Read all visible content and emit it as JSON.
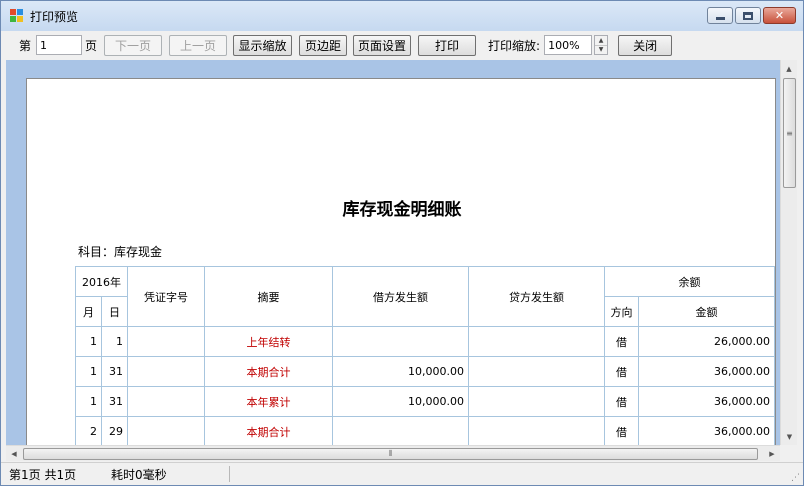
{
  "window": {
    "title": "打印预览"
  },
  "toolbar": {
    "page_prefix": "第",
    "page_value": "1",
    "page_suffix": "页",
    "next_label": "下一页",
    "prev_label": "上一页",
    "show_zoom_label": "显示缩放",
    "margins_label": "页边距",
    "page_setup_label": "页面设置",
    "print_label": "打印",
    "print_zoom_label": "打印缩放:",
    "print_zoom_value": "100%",
    "close_label": "关闭"
  },
  "document": {
    "title": "库存现金明细账",
    "subject": "科目：库存现金",
    "headers": {
      "year": "2016年",
      "month": "月",
      "day": "日",
      "voucher": "凭证字号",
      "summary": "摘要",
      "debit": "借方发生额",
      "credit": "贷方发生额",
      "balance": "余额",
      "direction": "方向",
      "amount": "金额"
    },
    "rows": [
      {
        "month": "1",
        "day": "1",
        "voucher": "",
        "summary": "上年结转",
        "debit": "",
        "credit": "",
        "direction": "借",
        "amount": "26,000.00"
      },
      {
        "month": "1",
        "day": "31",
        "voucher": "",
        "summary": "本期合计",
        "debit": "10,000.00",
        "credit": "",
        "direction": "借",
        "amount": "36,000.00"
      },
      {
        "month": "1",
        "day": "31",
        "voucher": "",
        "summary": "本年累计",
        "debit": "10,000.00",
        "credit": "",
        "direction": "借",
        "amount": "36,000.00"
      },
      {
        "month": "2",
        "day": "29",
        "voucher": "",
        "summary": "本期合计",
        "debit": "",
        "credit": "",
        "direction": "借",
        "amount": "36,000.00"
      }
    ]
  },
  "status": {
    "page_info": "第1页 共1页",
    "elapsed": "耗时0毫秒"
  },
  "colors": {
    "summary_text": "#c00000",
    "grid_line": "#a7c5de",
    "viewport_bg": "#a9c4e6"
  }
}
